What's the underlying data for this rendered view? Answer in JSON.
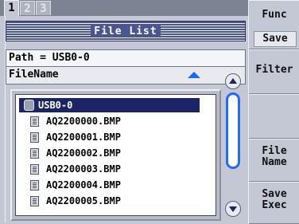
{
  "tabs": [
    "1",
    "2",
    "3"
  ],
  "dialog": {
    "title": "File List",
    "path": "Path = USB0-0",
    "column_header": "FileName"
  },
  "list": {
    "root": "USB0-0",
    "files": [
      "AQ2200000.BMP",
      "AQ2200001.BMP",
      "AQ2200002.BMP",
      "AQ2200003.BMP",
      "AQ2200004.BMP",
      "AQ2200005.BMP"
    ]
  },
  "softkeys": {
    "func_label": "Func",
    "func_value": "Save",
    "filter_label": "Filter",
    "blank_label": "",
    "filename_line1": "File",
    "filename_line2": "Name",
    "saveexec_line1": "Save",
    "saveexec_line2": "Exec"
  },
  "icons": {
    "root": "usb-drive-icon",
    "file": "file-icon",
    "sort": "sort-ascending-icon",
    "scroll_up": "scroll-up-icon",
    "scroll_down": "scroll-down-icon"
  },
  "colors": {
    "accent": "#1e6bff",
    "selection": "#1b2466",
    "titlebar": "#4b5691"
  }
}
